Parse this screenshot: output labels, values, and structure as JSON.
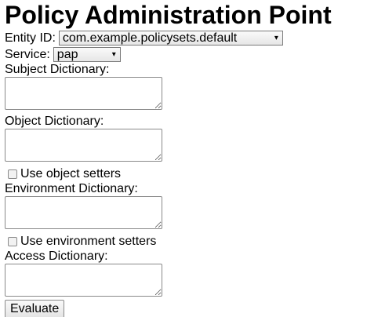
{
  "page": {
    "title": "Policy Administration Point"
  },
  "entity": {
    "label": "Entity ID:",
    "selected": "com.example.policysets.default"
  },
  "service": {
    "label": "Service:",
    "selected": "pap"
  },
  "subject": {
    "label": "Subject Dictionary:",
    "value": ""
  },
  "object": {
    "label": "Object Dictionary:",
    "value": "",
    "setters_label": "Use object setters",
    "setters_checked": false
  },
  "environment": {
    "label": "Environment Dictionary:",
    "value": "",
    "setters_label": "Use environment setters",
    "setters_checked": false
  },
  "access": {
    "label": "Access Dictionary:",
    "value": ""
  },
  "actions": {
    "evaluate_label": "Evaluate"
  },
  "icons": {
    "dropdown_arrow": "▾"
  }
}
